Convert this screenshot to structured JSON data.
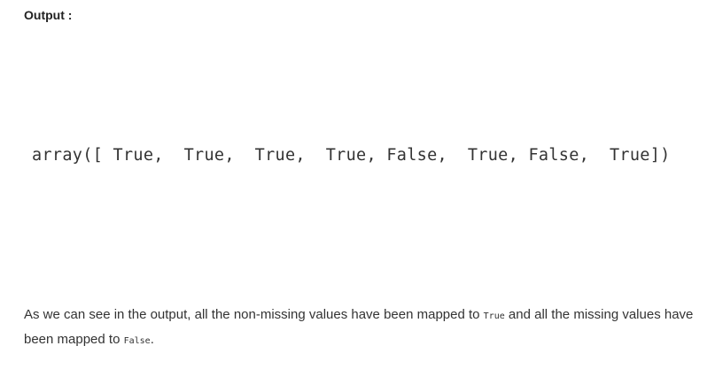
{
  "output_label": "Output :",
  "code_output": "array([ True,  True,  True,  True, False,  True, False,  True])",
  "explanation": {
    "part1": "As we can see in the output, all the non-missing values have been mapped to ",
    "code_true": "True",
    "part2": " and all the missing values have been mapped to ",
    "code_false": "False",
    "part3": "."
  }
}
